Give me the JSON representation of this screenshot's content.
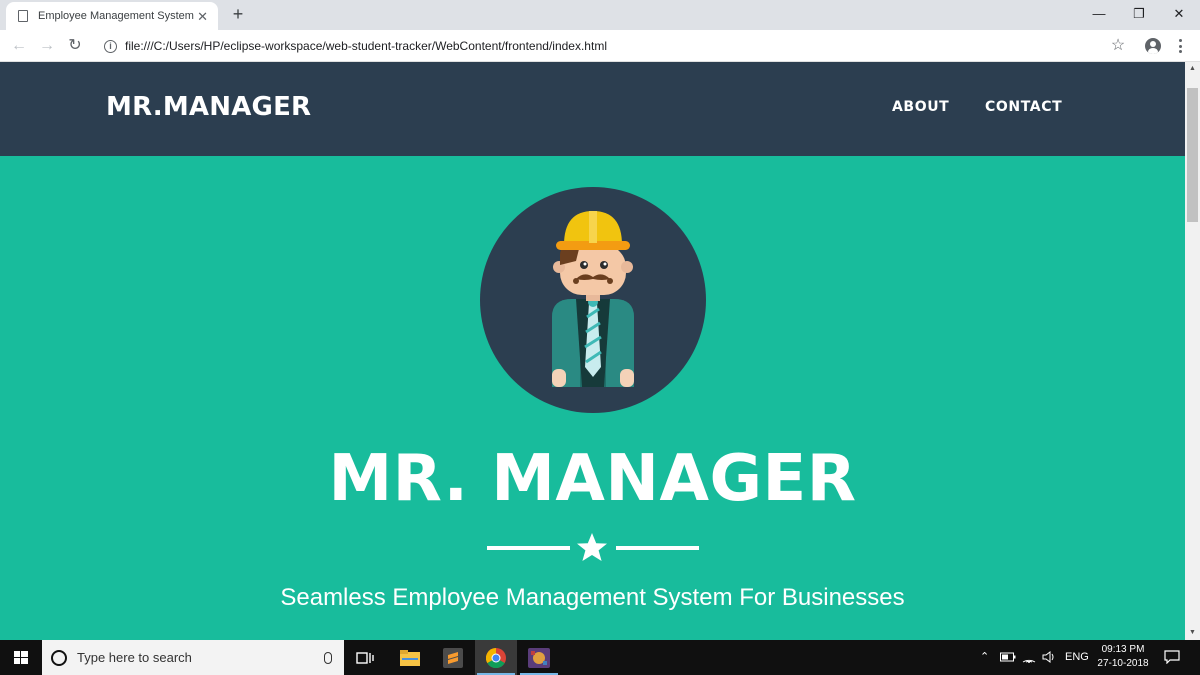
{
  "browser": {
    "tab_title": "Employee Management System",
    "tab_close": "✕",
    "new_tab": "+",
    "url": "file:///C:/Users/HP/eclipse-workspace/web-student-tracker/WebContent/frontend/index.html",
    "window_controls": {
      "minimize": "—",
      "restore": "❐",
      "close": "✕"
    }
  },
  "site": {
    "brand": "MR.MANAGER",
    "nav": [
      {
        "label": "ABOUT"
      },
      {
        "label": "CONTACT"
      }
    ],
    "hero": {
      "title": "MR. MANAGER",
      "tagline": "Seamless Employee Management System For Businesses"
    },
    "colors": {
      "navbar": "#2c3e50",
      "hero_bg": "#18bc9c",
      "avatar_circle": "#2c3e50",
      "helmet": "#f1c40f"
    }
  },
  "taskbar": {
    "search_placeholder": "Type here to search",
    "apps": [
      {
        "icon": "task-view-icon"
      },
      {
        "icon": "file-explorer-icon"
      },
      {
        "icon": "sublime-text-icon"
      },
      {
        "icon": "chrome-icon",
        "active": true
      },
      {
        "icon": "game-app-icon"
      }
    ],
    "tray": {
      "language": "ENG",
      "time": "09:13 PM",
      "date": "27-10-2018"
    }
  }
}
